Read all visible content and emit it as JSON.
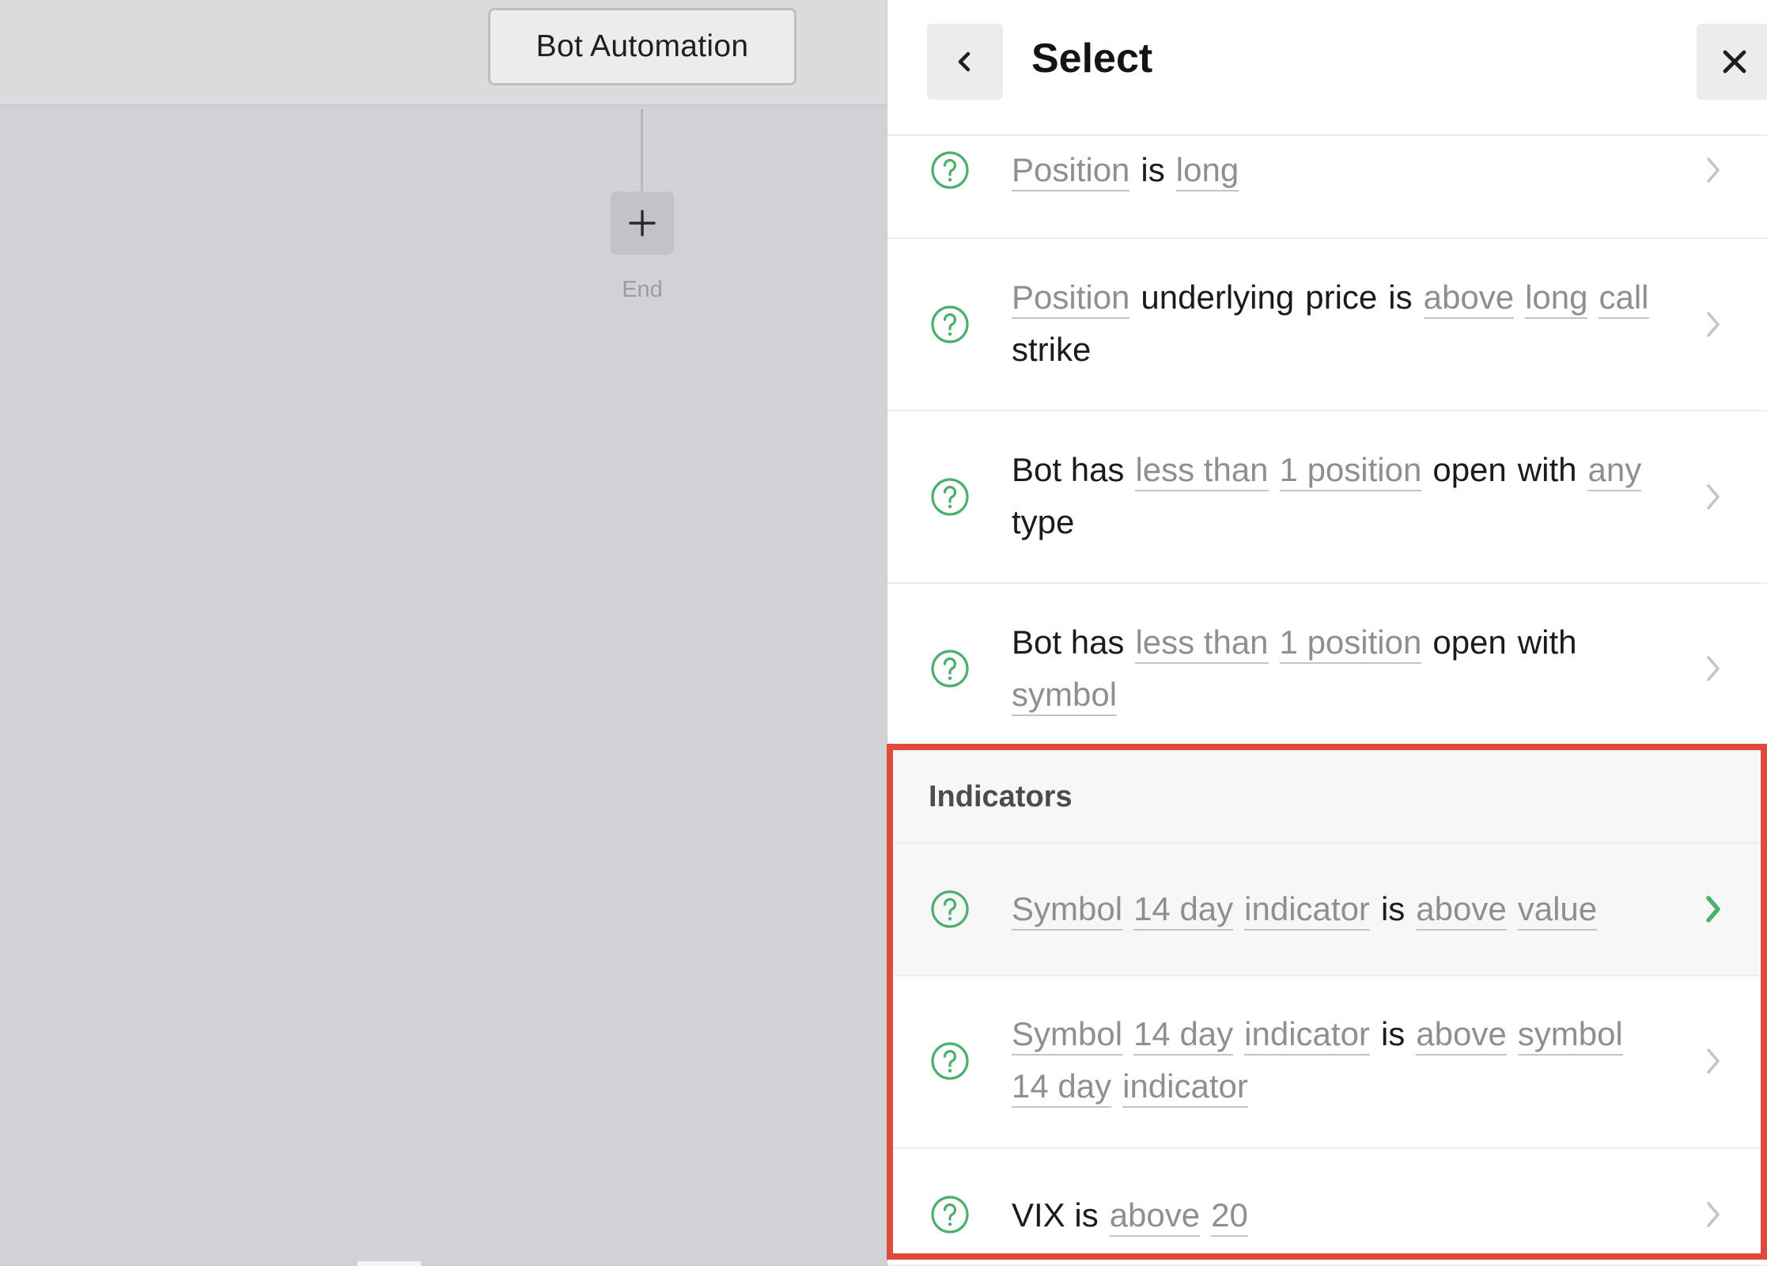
{
  "canvas": {
    "bot_node_label": "Bot Automation",
    "add_button_symbol": "+",
    "end_label": "End"
  },
  "panel": {
    "title": "Select",
    "back_icon": "chevron-left-icon",
    "close_icon": "close-icon"
  },
  "items": [
    {
      "tokens": [
        {
          "t": "Position",
          "v": true
        },
        {
          "t": "is",
          "v": false
        },
        {
          "t": "long",
          "v": true
        }
      ]
    },
    {
      "tokens": [
        {
          "t": "Position",
          "v": true
        },
        {
          "t": "underlying",
          "v": false
        },
        {
          "t": "price",
          "v": false
        },
        {
          "t": "is",
          "v": false
        },
        {
          "t": "above",
          "v": true
        },
        {
          "t": "long",
          "v": true
        },
        {
          "t": "call",
          "v": true
        },
        {
          "t": "strike",
          "v": false
        }
      ]
    },
    {
      "tokens": [
        {
          "t": "Bot has",
          "v": false
        },
        {
          "t": "less than",
          "v": true
        },
        {
          "t": "1 position",
          "v": true
        },
        {
          "t": "open",
          "v": false
        },
        {
          "t": "with",
          "v": false
        },
        {
          "t": "any",
          "v": true
        },
        {
          "t": "type",
          "v": false
        }
      ]
    },
    {
      "tokens": [
        {
          "t": "Bot has",
          "v": false
        },
        {
          "t": "less than",
          "v": true
        },
        {
          "t": "1 position",
          "v": true
        },
        {
          "t": "open",
          "v": false
        },
        {
          "t": "with",
          "v": false
        },
        {
          "t": "symbol",
          "v": true
        }
      ]
    }
  ],
  "indicators": {
    "section_title": "Indicators",
    "items": [
      {
        "tokens": [
          {
            "t": "Symbol",
            "v": true
          },
          {
            "t": "14 day",
            "v": true
          },
          {
            "t": "indicator",
            "v": true
          },
          {
            "t": "is",
            "v": false
          },
          {
            "t": "above",
            "v": true
          },
          {
            "t": "value",
            "v": true
          }
        ],
        "active": true
      },
      {
        "tokens": [
          {
            "t": "Symbol",
            "v": true
          },
          {
            "t": "14 day",
            "v": true
          },
          {
            "t": "indicator",
            "v": true
          },
          {
            "t": "is",
            "v": false
          },
          {
            "t": "above",
            "v": true
          },
          {
            "t": "symbol",
            "v": true
          },
          {
            "t": "14 day",
            "v": true
          },
          {
            "t": "indicator",
            "v": true
          }
        ],
        "active": false
      },
      {
        "tokens": [
          {
            "t": "VIX is",
            "v": false
          },
          {
            "t": "above",
            "v": true
          },
          {
            "t": "20",
            "v": true
          }
        ],
        "active": false
      }
    ]
  },
  "colors": {
    "accent_green": "#4caf6e",
    "chevron_grey": "#c4c5c8",
    "highlight_frame": "#e04a3c"
  }
}
